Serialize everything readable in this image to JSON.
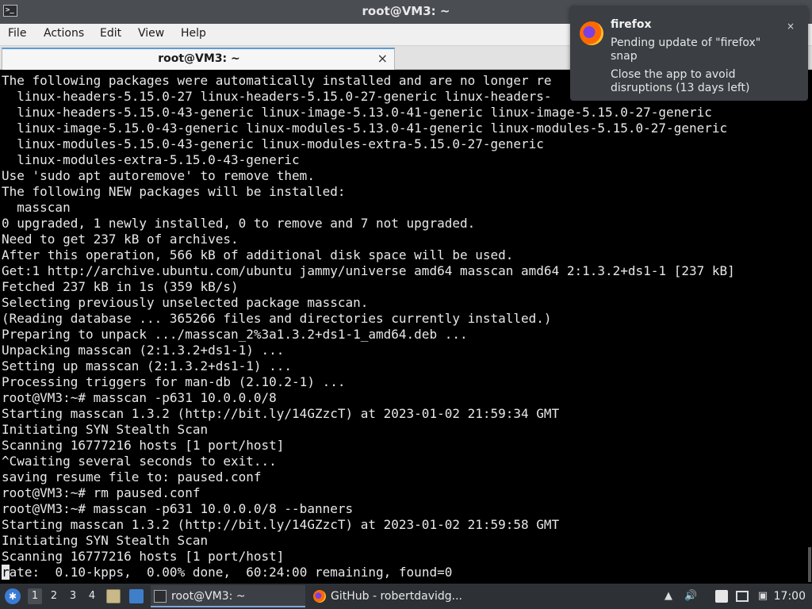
{
  "window": {
    "title": "root@VM3: ~",
    "terminal_icon_glyph": ">_"
  },
  "menubar": {
    "items": [
      "File",
      "Actions",
      "Edit",
      "View",
      "Help"
    ]
  },
  "tabs": [
    {
      "label": "root@VM3: ~",
      "close_glyph": "×"
    }
  ],
  "terminal": {
    "lines": [
      "The following packages were automatically installed and are no longer re",
      "  linux-headers-5.15.0-27 linux-headers-5.15.0-27-generic linux-headers-",
      "  linux-headers-5.15.0-43-generic linux-image-5.13.0-41-generic linux-image-5.15.0-27-generic",
      "  linux-image-5.15.0-43-generic linux-modules-5.13.0-41-generic linux-modules-5.15.0-27-generic",
      "  linux-modules-5.15.0-43-generic linux-modules-extra-5.15.0-27-generic",
      "  linux-modules-extra-5.15.0-43-generic",
      "Use 'sudo apt autoremove' to remove them.",
      "The following NEW packages will be installed:",
      "  masscan",
      "0 upgraded, 1 newly installed, 0 to remove and 7 not upgraded.",
      "Need to get 237 kB of archives.",
      "After this operation, 566 kB of additional disk space will be used.",
      "Get:1 http://archive.ubuntu.com/ubuntu jammy/universe amd64 masscan amd64 2:1.3.2+ds1-1 [237 kB]",
      "Fetched 237 kB in 1s (359 kB/s)",
      "Selecting previously unselected package masscan.",
      "(Reading database ... 365266 files and directories currently installed.)",
      "Preparing to unpack .../masscan_2%3a1.3.2+ds1-1_amd64.deb ...",
      "Unpacking masscan (2:1.3.2+ds1-1) ...",
      "Setting up masscan (2:1.3.2+ds1-1) ...",
      "Processing triggers for man-db (2.10.2-1) ...",
      "root@VM3:~# masscan -p631 10.0.0.0/8",
      "Starting masscan 1.3.2 (http://bit.ly/14GZzcT) at 2023-01-02 21:59:34 GMT",
      "Initiating SYN Stealth Scan",
      "Scanning 16777216 hosts [1 port/host]",
      "^Cwaiting several seconds to exit...",
      "saving resume file to: paused.conf",
      "root@VM3:~# rm paused.conf",
      "root@VM3:~# masscan -p631 10.0.0.0/8 --banners",
      "Starting masscan 1.3.2 (http://bit.ly/14GZzcT) at 2023-01-02 21:59:58 GMT",
      "Initiating SYN Stealth Scan",
      "Scanning 16777216 hosts [1 port/host]"
    ],
    "cursor_line": {
      "cursor_char": "r",
      "rest": "ate:  0.10-kpps,  0.00% done,  60:24:00 remaining, found=0"
    }
  },
  "notification": {
    "app_name": "firefox",
    "body_line1": "Pending update of \"firefox\" snap",
    "body_line2": "Close the app to avoid disruptions (13 days left)",
    "close_glyph": "×",
    "icon": "firefox-icon"
  },
  "taskbar": {
    "workspaces": [
      "1",
      "2",
      "3",
      "4"
    ],
    "active_workspace": "1",
    "tasks": [
      {
        "label": "root@VM3: ~",
        "icon": "terminal-icon",
        "active": true
      },
      {
        "label": "GitHub - robertdavidg...",
        "icon": "firefox-icon",
        "active": false
      }
    ],
    "clock": "17:00"
  },
  "colors": {
    "titlebar_bg": "#4a4d52",
    "terminal_bg": "#000000",
    "terminal_fg": "#e8e8e8",
    "taskbar_bg": "#2d3035",
    "notification_bg": "#3b3e43",
    "tab_accent": "#5b9bd5"
  }
}
